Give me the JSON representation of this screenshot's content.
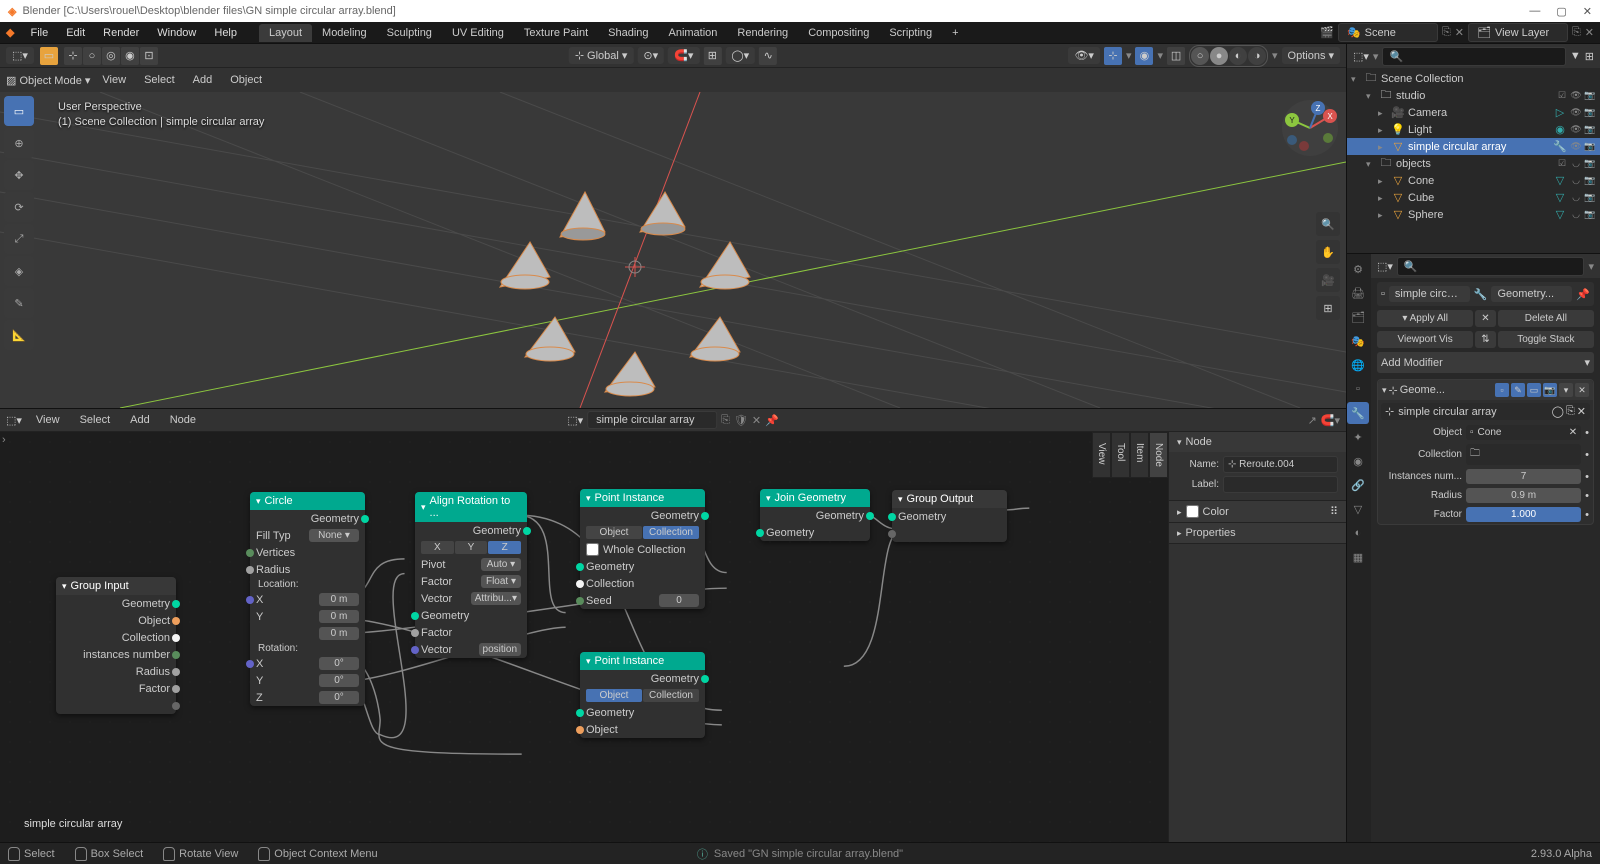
{
  "titlebar": {
    "app": "Blender",
    "path": "[C:\\Users\\rouel\\Desktop\\blender files\\GN simple circular array.blend]"
  },
  "menubar": {
    "items": [
      "File",
      "Edit",
      "Render",
      "Window",
      "Help"
    ],
    "tabs": [
      "Layout",
      "Modeling",
      "Sculpting",
      "UV Editing",
      "Texture Paint",
      "Shading",
      "Animation",
      "Rendering",
      "Compositing",
      "Scripting"
    ],
    "active_tab": 0,
    "scene_label": "Scene",
    "layer_label": "View Layer"
  },
  "viewport_header": {
    "mode": "Object Mode",
    "menus": [
      "View",
      "Select",
      "Add",
      "Object"
    ],
    "orient": "Global",
    "options_label": "Options"
  },
  "viewport": {
    "persp": "User Perspective",
    "info": "(1) Scene Collection | simple circular array"
  },
  "node_header": {
    "menus": [
      "View",
      "Select",
      "Add",
      "Node"
    ],
    "tree_name": "simple circular array"
  },
  "node_panel": {
    "node_label": "Node",
    "name_label": "Name:",
    "name_value": "Reroute.004",
    "label_label": "Label:",
    "color_label": "Color",
    "props_label": "Properties"
  },
  "nodes": {
    "group_input": {
      "title": "Group Input",
      "outs": [
        "Geometry",
        "Object",
        "Collection",
        "instances number",
        "Radius",
        "Factor"
      ]
    },
    "circle": {
      "title": "Circle",
      "out_geom": "Geometry",
      "fill_label": "Fill Typ",
      "fill_val": "None",
      "ins": [
        "Vertices",
        "Radius"
      ],
      "loc_label": "Location:",
      "rot_label": "Rotation:",
      "xyz": [
        "X",
        "Y",
        "Z"
      ],
      "zeros_m": "0 m",
      "zeros_deg": "0°"
    },
    "align": {
      "title": "Align Rotation to ...",
      "out_geom": "Geometry",
      "axes": [
        "X",
        "Y",
        "Z"
      ],
      "pivot_label": "Pivot",
      "pivot_val": "Auto",
      "factor_label": "Factor",
      "factor_val": "Float",
      "vector_label": "Vector",
      "vector_val": "Attribu...",
      "ins": [
        "Geometry",
        "Factor",
        "Vector"
      ],
      "posn": "position"
    },
    "pinst1": {
      "title": "Point Instance",
      "out_geom": "Geometry",
      "mode_object": "Object",
      "mode_collection": "Collection",
      "whole": "Whole Collection",
      "ins": [
        "Geometry",
        "Collection"
      ],
      "seed_label": "Seed",
      "seed_val": "0"
    },
    "pinst2": {
      "title": "Point Instance",
      "out_geom": "Geometry",
      "mode_object": "Object",
      "mode_collection": "Collection",
      "ins": [
        "Geometry",
        "Object"
      ]
    },
    "join": {
      "title": "Join Geometry",
      "out": "Geometry",
      "in": "Geometry"
    },
    "group_output": {
      "title": "Group Output",
      "in": "Geometry"
    }
  },
  "node_footer_label": "simple circular array",
  "outliner": {
    "root": "Scene Collection",
    "studio": "studio",
    "camera": "Camera",
    "light": "Light",
    "active": "simple circular array",
    "objects": "objects",
    "cone": "Cone",
    "cube": "Cube",
    "sphere": "Sphere"
  },
  "properties": {
    "crumb1": "simple circula...",
    "crumb2": "Geometry...",
    "apply_all": "Apply All",
    "delete_all": "Delete All",
    "viewport_vis": "Viewport Vis",
    "toggle_stack": "Toggle Stack",
    "add_modifier": "Add Modifier",
    "mod_name_short": "Geome...",
    "mod_tree": "simple circular array",
    "obj_label": "Object",
    "obj_val": "Cone",
    "coll_label": "Collection",
    "inst_label": "Instances num...",
    "inst_val": "7",
    "radius_label": "Radius",
    "radius_val": "0.9 m",
    "factor_label": "Factor",
    "factor_val": "1.000"
  },
  "statusbar": {
    "select": "Select",
    "box": "Box Select",
    "rotate": "Rotate View",
    "context": "Object Context Menu",
    "saved": "Saved \"GN simple circular array.blend\"",
    "version": "2.93.0 Alpha"
  },
  "npanel_tabs": [
    "Node",
    "Item",
    "Tool",
    "View"
  ]
}
